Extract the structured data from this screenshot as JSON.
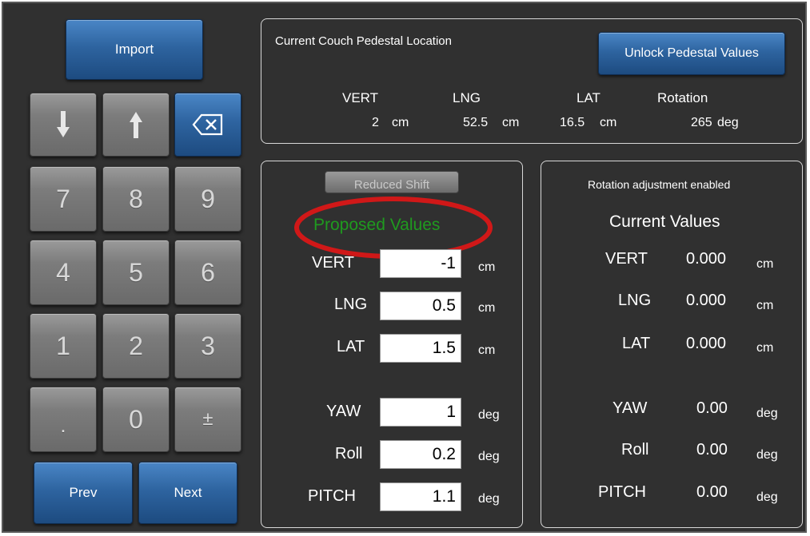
{
  "keypad": {
    "import_label": "Import",
    "prev_label": "Prev",
    "next_label": "Next",
    "keys": {
      "k7": "7",
      "k8": "8",
      "k9": "9",
      "k4": "4",
      "k5": "5",
      "k6": "6",
      "k1": "1",
      "k2": "2",
      "k3": "3",
      "kdot": ".",
      "k0": "0",
      "kpm": "±"
    }
  },
  "pedestal": {
    "title": "Current Couch Pedestal Location",
    "unlock_label": "Unlock Pedestal Values",
    "headers": {
      "vert": "VERT",
      "lng": "LNG",
      "lat": "LAT",
      "rotation": "Rotation"
    },
    "values": {
      "vert": "2",
      "vert_unit": "cm",
      "lng": "52.5",
      "lng_unit": "cm",
      "lat": "16.5",
      "lat_unit": "cm",
      "rotation": "265",
      "rotation_unit": "deg"
    }
  },
  "proposed": {
    "reduced_shift_label": "Reduced Shift",
    "title": "Proposed Values",
    "title_color": "#1f9a1f",
    "highlight_color": "#d01818",
    "rows": [
      {
        "label": "VERT",
        "value": "-1",
        "unit": "cm"
      },
      {
        "label": "LNG",
        "value": "0.5",
        "unit": "cm"
      },
      {
        "label": "LAT",
        "value": "1.5",
        "unit": "cm"
      },
      {
        "label": "YAW",
        "value": "1",
        "unit": "deg"
      },
      {
        "label": "Roll",
        "value": "0.2",
        "unit": "deg"
      },
      {
        "label": "PITCH",
        "value": "1.1",
        "unit": "deg"
      }
    ]
  },
  "current": {
    "status": "Rotation adjustment enabled",
    "title": "Current Values",
    "rows": [
      {
        "label": "VERT",
        "value": "0.000",
        "unit": "cm"
      },
      {
        "label": "LNG",
        "value": "0.000",
        "unit": "cm"
      },
      {
        "label": "LAT",
        "value": "0.000",
        "unit": "cm"
      },
      {
        "label": "YAW",
        "value": "0.00",
        "unit": "deg"
      },
      {
        "label": "Roll",
        "value": "0.00",
        "unit": "deg"
      },
      {
        "label": "PITCH",
        "value": "0.00",
        "unit": "deg"
      }
    ]
  },
  "icons": {
    "down": "arrow-down-icon",
    "up": "arrow-up-icon",
    "backspace": "backspace-icon"
  }
}
